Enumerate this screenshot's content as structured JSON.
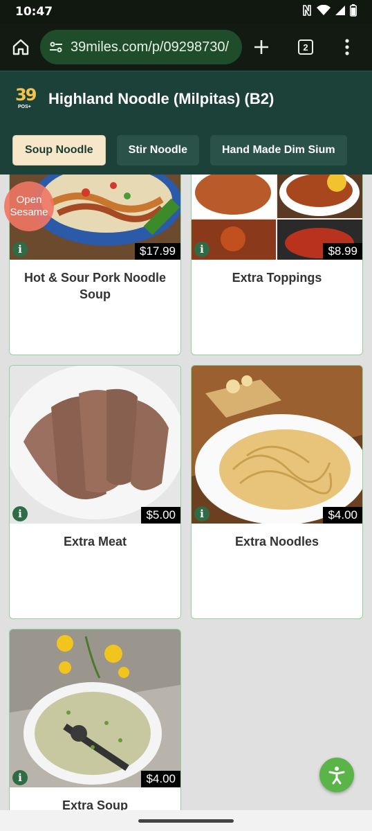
{
  "status_bar": {
    "time": "10:47",
    "battery": "5"
  },
  "browser": {
    "url": "39miles.com/p/09298730/",
    "tab_count": "2"
  },
  "header": {
    "logo_text": "39",
    "logo_sub": "POS+",
    "title": "Highland Noodle (Milpitas) (B2)"
  },
  "categories": [
    {
      "label": "Soup Noodle",
      "active": true
    },
    {
      "label": "Stir Noodle",
      "active": false
    },
    {
      "label": "Hand Made Dim Sium",
      "active": false
    }
  ],
  "badge": {
    "line1": "Open",
    "line2": "Sesame"
  },
  "items": [
    {
      "name": "Hot & Sour Pork Noodle Soup",
      "price": "$17.99"
    },
    {
      "name": "Extra Toppings",
      "price": "$8.99"
    },
    {
      "name": "Extra Meat",
      "price": "$5.00"
    },
    {
      "name": "Extra Noodles",
      "price": "$4.00"
    },
    {
      "name": "Extra Soup",
      "price": "$4.00"
    }
  ],
  "info_icon_glyph": "i",
  "colors": {
    "header_bg": "#1c4139",
    "active_tab_bg": "#f5e7c8",
    "card_border": "#8ed19a",
    "fab": "#5bb447",
    "badge": "#f07664"
  }
}
